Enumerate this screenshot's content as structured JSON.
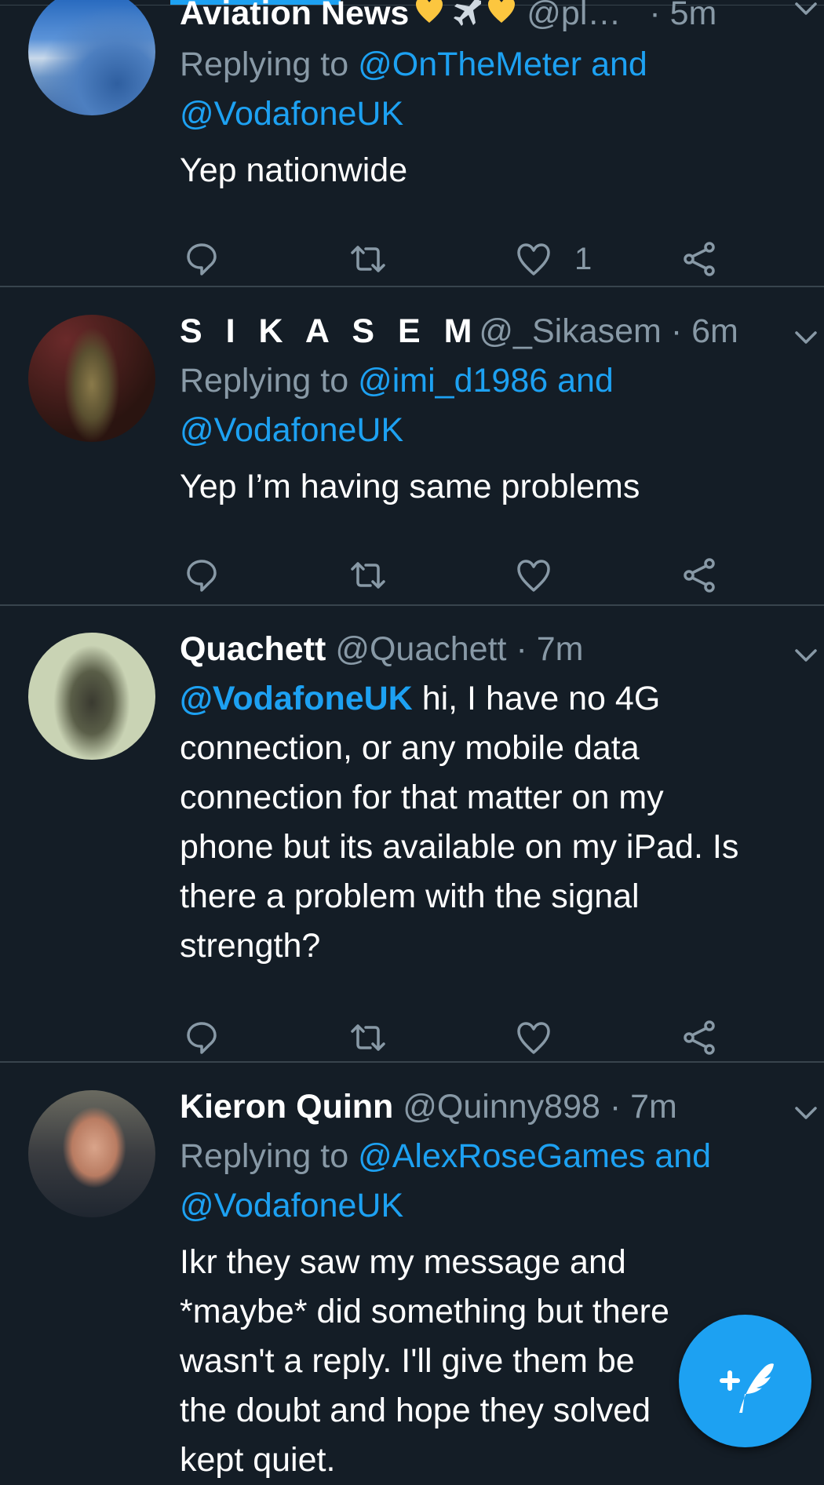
{
  "colors": {
    "background": "#141d26",
    "accent": "#1da1f2",
    "muted": "#8899a6",
    "divider": "#38444d"
  },
  "tweets": [
    {
      "name": "Aviation News",
      "name_emoji_icons": [
        "yellow-heart-icon",
        "airplane-icon",
        "yellow-heart-icon"
      ],
      "handle": "@pl…",
      "time": "· 5m",
      "replying_prefix": "Replying to",
      "replying_line1": "@OnTheMeter and",
      "replying_line2": "@VodafoneUK",
      "body": [
        "Yep nationwide"
      ],
      "like_count": "1"
    },
    {
      "name": "S I K A  S E M",
      "handle": "@_Sikasem",
      "time": "· 6m",
      "replying_prefix": "Replying to",
      "replying_line1": "@imi_d1986 and",
      "replying_line2": "@VodafoneUK",
      "body": [
        "Yep I’m having same problems"
      ],
      "like_count": ""
    },
    {
      "name": "Quachett",
      "handle": "@Quachett",
      "time": "· 7m",
      "mention": "@VodafoneUK",
      "body": [
        " hi, I have no 4G",
        "connection, or any mobile data",
        "connection for that matter on my",
        "phone but its available on my iPad. Is",
        "there a problem with the signal",
        "strength?"
      ],
      "like_count": ""
    },
    {
      "name": "Kieron Quinn",
      "handle": "@Quinny898",
      "time": "· 7m",
      "replying_prefix": "Replying to",
      "replying_line1": "@AlexRoseGames and",
      "replying_line2": "@VodafoneUK",
      "body": [
        "Ikr they saw my message and",
        "*maybe* did something but there",
        "wasn't a reply. I'll give them be",
        "the doubt and hope they solved",
        "kept quiet."
      ],
      "like_count": ""
    }
  ],
  "fab": {
    "icon": "compose-tweet-icon"
  }
}
